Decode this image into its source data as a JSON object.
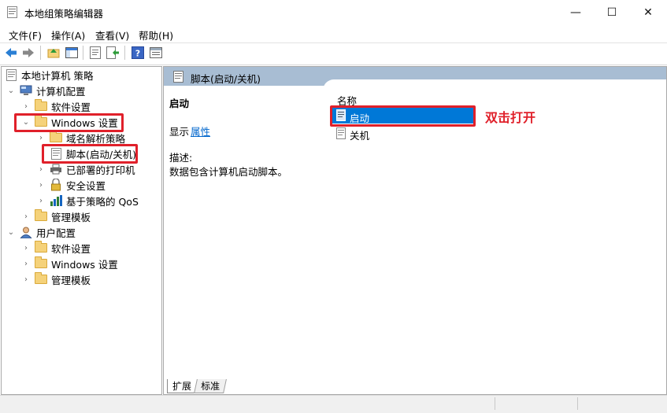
{
  "window": {
    "title": "本地组策略编辑器",
    "controls": {
      "minimize": "—",
      "maximize": "☐",
      "close": "✕"
    }
  },
  "menu": [
    "文件(F)",
    "操作(A)",
    "查看(V)",
    "帮助(H)"
  ],
  "tree": {
    "root": "本地计算机 策略",
    "computer_config": "计算机配置",
    "cc_software": "软件设置",
    "cc_windows": "Windows 设置",
    "cc_dns": "域名解析策略",
    "cc_scripts": "脚本(启动/关机)",
    "cc_printers": "已部署的打印机",
    "cc_security": "安全设置",
    "cc_qos": "基于策略的 QoS",
    "cc_admin": "管理模板",
    "user_config": "用户配置",
    "uc_software": "软件设置",
    "uc_windows": "Windows 设置",
    "uc_admin": "管理模板"
  },
  "detail": {
    "header": "脚本(启动/关机)",
    "heading": "启动",
    "display_label": "显示",
    "display_link": "属性",
    "desc_label": "描述:",
    "desc_text": "数据包含计算机启动脚本。"
  },
  "list": {
    "column_header": "名称",
    "items": [
      "启动",
      "关机"
    ]
  },
  "annotation": "双击打开",
  "tabs": [
    "扩展",
    "标准"
  ],
  "colors": {
    "accent_red": "#e0202a",
    "selection_blue": "#0078d7",
    "header_bar": "#a8bdd3",
    "folder_yellow": "#f5d27a"
  }
}
